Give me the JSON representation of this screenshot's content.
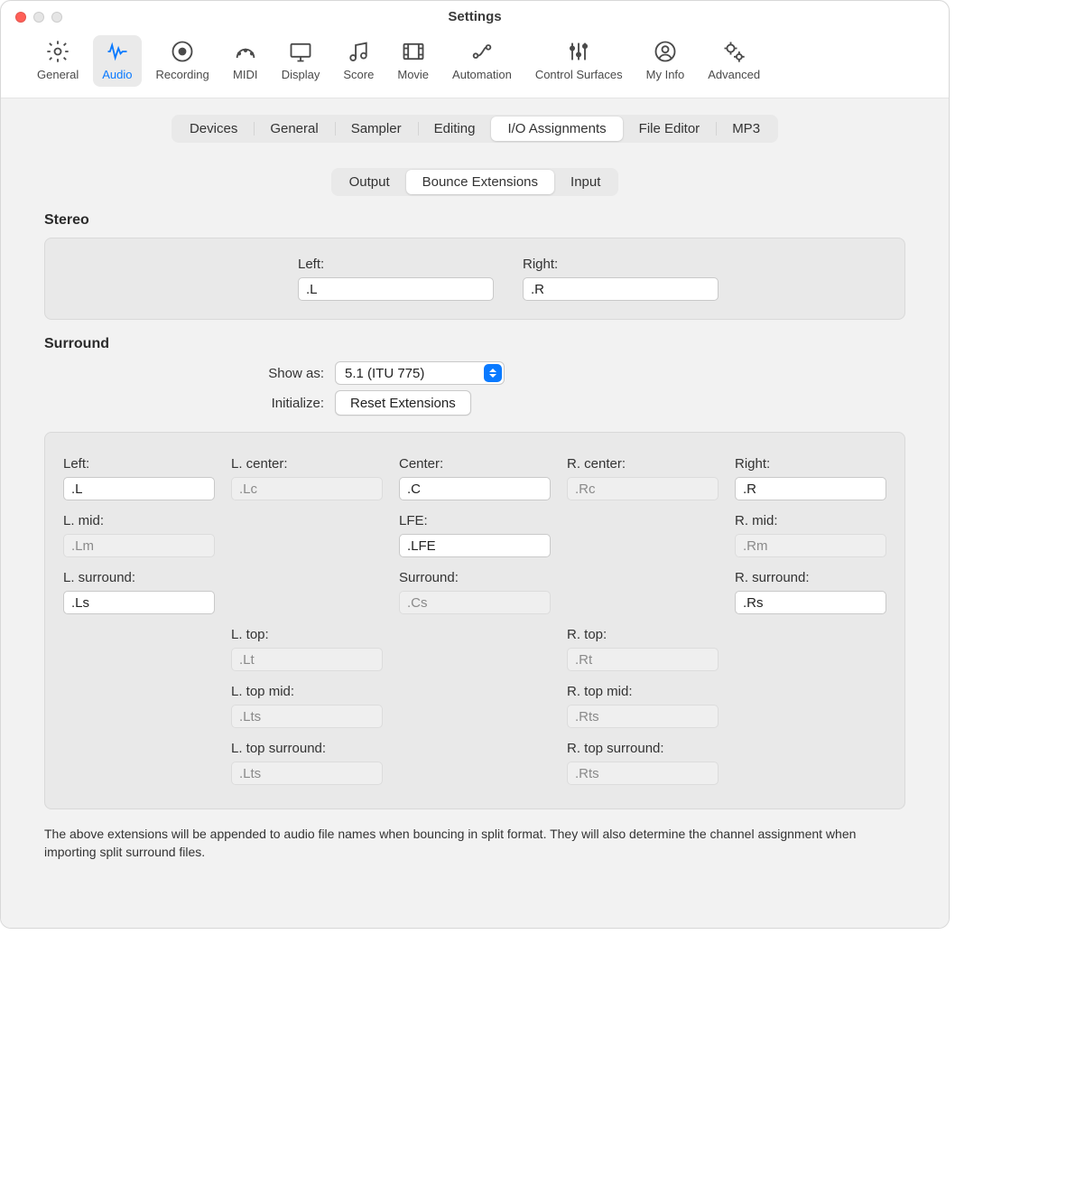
{
  "window": {
    "title": "Settings"
  },
  "toolbar": [
    {
      "id": "general",
      "label": "General"
    },
    {
      "id": "audio",
      "label": "Audio",
      "selected": true
    },
    {
      "id": "recording",
      "label": "Recording"
    },
    {
      "id": "midi",
      "label": "MIDI"
    },
    {
      "id": "display",
      "label": "Display"
    },
    {
      "id": "score",
      "label": "Score"
    },
    {
      "id": "movie",
      "label": "Movie"
    },
    {
      "id": "automation",
      "label": "Automation"
    },
    {
      "id": "control-surfaces",
      "label": "Control Surfaces"
    },
    {
      "id": "my-info",
      "label": "My Info"
    },
    {
      "id": "advanced",
      "label": "Advanced"
    }
  ],
  "tabs1": [
    "Devices",
    "General",
    "Sampler",
    "Editing",
    "I/O Assignments",
    "File Editor",
    "MP3"
  ],
  "tabs1_selected": "I/O Assignments",
  "tabs2": [
    "Output",
    "Bounce Extensions",
    "Input"
  ],
  "tabs2_selected": "Bounce Extensions",
  "stereo": {
    "title": "Stereo",
    "left_label": "Left:",
    "right_label": "Right:",
    "left": ".L",
    "right": ".R"
  },
  "surround": {
    "title": "Surround",
    "show_as_label": "Show as:",
    "show_as": "5.1 (ITU 775)",
    "initialize_label": "Initialize:",
    "reset_button": "Reset Extensions",
    "fields": {
      "left": {
        "label": "Left:",
        "value": ".L",
        "enabled": true
      },
      "l_center": {
        "label": "L. center:",
        "value": ".Lc",
        "enabled": false
      },
      "center": {
        "label": "Center:",
        "value": ".C",
        "enabled": true
      },
      "r_center": {
        "label": "R. center:",
        "value": ".Rc",
        "enabled": false
      },
      "right": {
        "label": "Right:",
        "value": ".R",
        "enabled": true
      },
      "l_mid": {
        "label": "L. mid:",
        "value": ".Lm",
        "enabled": false
      },
      "lfe": {
        "label": "LFE:",
        "value": ".LFE",
        "enabled": true
      },
      "r_mid": {
        "label": "R. mid:",
        "value": ".Rm",
        "enabled": false
      },
      "l_surround": {
        "label": "L. surround:",
        "value": ".Ls",
        "enabled": true
      },
      "c_surround": {
        "label": "Surround:",
        "value": ".Cs",
        "enabled": false
      },
      "r_surround": {
        "label": "R. surround:",
        "value": ".Rs",
        "enabled": true
      },
      "l_top": {
        "label": "L. top:",
        "value": ".Lt",
        "enabled": false
      },
      "r_top": {
        "label": "R. top:",
        "value": ".Rt",
        "enabled": false
      },
      "l_top_mid": {
        "label": "L. top mid:",
        "value": ".Lts",
        "enabled": false
      },
      "r_top_mid": {
        "label": "R. top mid:",
        "value": ".Rts",
        "enabled": false
      },
      "l_top_sur": {
        "label": "L. top surround:",
        "value": ".Lts",
        "enabled": false
      },
      "r_top_sur": {
        "label": "R. top surround:",
        "value": ".Rts",
        "enabled": false
      }
    }
  },
  "footnote": "The above extensions will be appended to audio file names when bouncing in split format. They will also determine the channel assignment when importing split surround files."
}
